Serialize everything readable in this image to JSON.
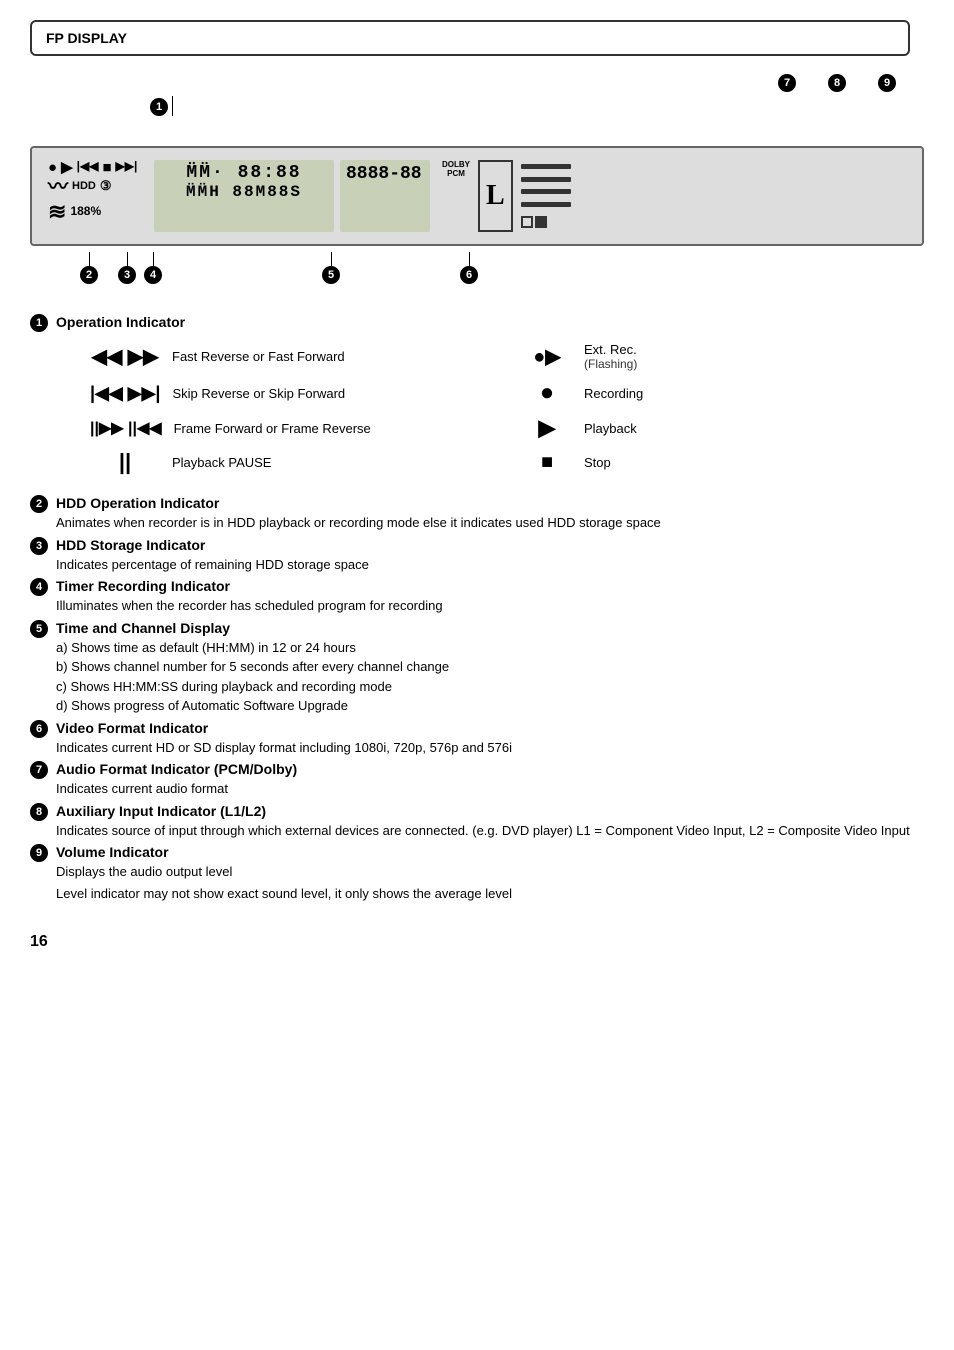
{
  "header": {
    "title": "FP DISPLAY"
  },
  "display": {
    "op_symbols_row1": "●▶ |◀◀ ■ ▶▶|",
    "hdd_label": "HDD",
    "hdd_pct": "188%",
    "timer_icon": "③",
    "seg_top": "MM̈  MM̈·  88:  88",
    "seg_bot": "MM̈  MM̈H  88M  88S",
    "ch_top": "8888·88",
    "ch_bot": "",
    "dolby": "DOLBY",
    "pcm": "PCM",
    "callouts": [
      "1",
      "2",
      "3",
      "4",
      "5",
      "6",
      "7",
      "8",
      "9"
    ]
  },
  "section1": {
    "num": "1",
    "title": "Operation Indicator",
    "items": [
      {
        "symbol": "◀◀ ▶▶",
        "desc": "Fast Reverse or Fast Forward"
      },
      {
        "symbol": "●▶",
        "desc": "Ext. Rec.",
        "sub": "(Flashing)"
      },
      {
        "symbol": "|◀◀ ▶▶|",
        "desc": "Skip Reverse or Skip Forward"
      },
      {
        "symbol": "●",
        "desc": "Recording"
      },
      {
        "symbol": "||▶▶ ||◀◀",
        "desc": "Frame Forward or Frame Reverse"
      },
      {
        "symbol": "▶",
        "desc": "Playback"
      },
      {
        "symbol": "||",
        "desc": "Playback PAUSE"
      },
      {
        "symbol": "■",
        "desc": "Stop"
      }
    ]
  },
  "section2": {
    "num": "2",
    "title": "HDD Operation Indicator",
    "desc": "Animates when recorder is in HDD playback or recording mode else it indicates used HDD storage space"
  },
  "section3": {
    "num": "3",
    "title": "HDD Storage Indicator",
    "desc": "Indicates percentage of remaining HDD storage space"
  },
  "section4": {
    "num": "4",
    "title": "Timer Recording Indicator",
    "desc": "Illuminates when the recorder has scheduled program for recording"
  },
  "section5": {
    "num": "5",
    "title": "Time and Channel Display",
    "items": [
      "a) Shows time as default (HH:MM) in 12 or 24 hours",
      "b) Shows channel number for 5 seconds after every channel change",
      "c) Shows HH:MM:SS during playback and recording mode",
      "d) Shows progress of Automatic Software Upgrade"
    ]
  },
  "section6": {
    "num": "6",
    "title": "Video Format Indicator",
    "desc": "Indicates current HD or SD display format including 1080i, 720p, 576p and 576i"
  },
  "section7": {
    "num": "7",
    "title": "Audio Format Indicator (PCM/Dolby)",
    "desc": "Indicates current audio format"
  },
  "section8": {
    "num": "8",
    "title": "Auxiliary Input Indicator (L1/L2)",
    "desc": "Indicates source of input through which external devices are connected. (e.g. DVD player) L1 = Component Video Input, L2 = Composite Video Input"
  },
  "section9": {
    "num": "9",
    "title": "Volume Indicator",
    "desc1": "Displays the audio output level",
    "desc2": "Level indicator may not show exact sound level, it only shows the average level"
  },
  "page_num": "16"
}
